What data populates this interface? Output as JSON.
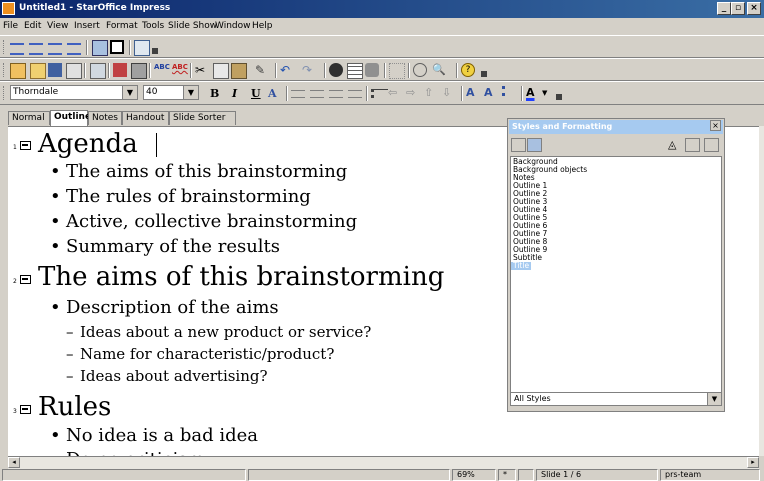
{
  "window": {
    "title": "Untitled1 - StarOffice Impress",
    "buttons": [
      "_",
      "▫",
      "×"
    ]
  },
  "menu": [
    "File",
    "Edit",
    "View",
    "Insert",
    "Format",
    "Tools",
    "Slide Show",
    "Window",
    "Help"
  ],
  "format_toolbar": {
    "font_name": "Thorndale",
    "font_size": "40",
    "bold": "B",
    "italic": "I",
    "underline": "U",
    "shadow": "A"
  },
  "view_tabs": {
    "normal": "Normal",
    "outline": "Outline",
    "notes": "Notes",
    "handout": "Handout",
    "slide_sorter": "Slide Sorter",
    "active": "Outline"
  },
  "outline": {
    "slides": [
      {
        "num": "1",
        "title": "Agenda",
        "points": [
          {
            "text": "The aims of this brainstorming"
          },
          {
            "text": "The rules of brainstorming"
          },
          {
            "text": "Active, collective brainstorming"
          },
          {
            "text": "Summary of the results"
          }
        ]
      },
      {
        "num": "2",
        "title": "The aims of this brainstorming",
        "points": [
          {
            "text": "Description of the aims"
          }
        ],
        "subpoints": [
          "Ideas about a new product or service?",
          "Name for characteristic/product?",
          "Ideas about advertising?"
        ]
      },
      {
        "num": "3",
        "title": "Rules",
        "points": [
          {
            "text": "No idea is a bad idea"
          },
          {
            "text": "Do no criticism"
          }
        ]
      }
    ]
  },
  "styles_panel": {
    "title": "Styles and Formatting",
    "items": [
      "Background",
      "Background objects",
      "Notes",
      "Outline 1",
      "Outline 2",
      "Outline 3",
      "Outline 4",
      "Outline 5",
      "Outline 6",
      "Outline 7",
      "Outline 8",
      "Outline 9",
      "Subtitle",
      "Title"
    ],
    "selected": "Title",
    "filter": "All Styles"
  },
  "status": {
    "zoom": "69%",
    "modified": "*",
    "slide": "Slide 1 / 6",
    "layout": "prs-team"
  },
  "colors": {
    "titlebar_start": "#0a246a",
    "titlebar_end": "#3a6ea5",
    "panel_title": "#a6caf0",
    "chrome": "#d4d0c8"
  }
}
